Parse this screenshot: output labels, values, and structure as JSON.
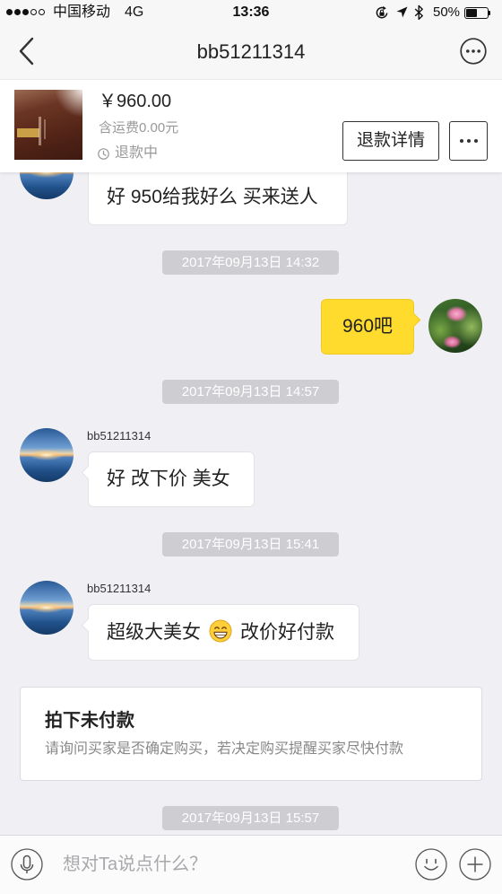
{
  "status_bar": {
    "signal_bars": 3,
    "signal_max": 5,
    "carrier": "中国移动",
    "network": "4G",
    "time": "13:36",
    "battery_text": "50%",
    "battery_level": 0.5,
    "icons": {
      "orientation_lock": "rotation-lock-icon",
      "location": "location-arrow-icon",
      "bluetooth": "bluetooth-icon",
      "battery": "battery-icon"
    }
  },
  "nav": {
    "title": "bb51211314",
    "back_icon": "chevron-left-icon",
    "more_icon": "more-circle-icon"
  },
  "product": {
    "price": "￥960.00",
    "shipping": "含运费0.00元",
    "status": "退款中",
    "status_icon": "clock-icon",
    "refund_button": "退款详情",
    "more_button_icon": "ellipsis-icon"
  },
  "messages": [
    {
      "outgoing": false,
      "text": "好 950给我好么 买来送人"
    },
    {
      "time": "2017年09月13日 14:32"
    },
    {
      "outgoing": true,
      "text": "960吧"
    },
    {
      "time": "2017年09月13日 14:57"
    },
    {
      "outgoing": false,
      "sender": "bb51211314",
      "text": "好 改下价 美女"
    },
    {
      "time": "2017年09月13日 15:41"
    },
    {
      "outgoing": false,
      "sender": "bb51211314",
      "text_before": "超级大美女",
      "emoji": "grinning-face-emoji",
      "text_after": "改价好付款"
    },
    {
      "notice_title": "拍下未付款",
      "notice_text": "请询问买家是否确定购买，若决定购买提醒买家尽快付款"
    },
    {
      "time": "2017年09月13日 15:57"
    }
  ],
  "input_bar": {
    "placeholder": "想对Ta说点什么？",
    "voice_icon": "microphone-icon",
    "emoji_icon": "smiley-icon",
    "add_icon": "plus-icon"
  },
  "colors": {
    "chat_background": "#f0f0f4",
    "bubble_self": "#ffdb2e",
    "bubble_other": "#ffffff",
    "timestamp_pill": "#cdcdd2",
    "muted_text": "#999999"
  }
}
